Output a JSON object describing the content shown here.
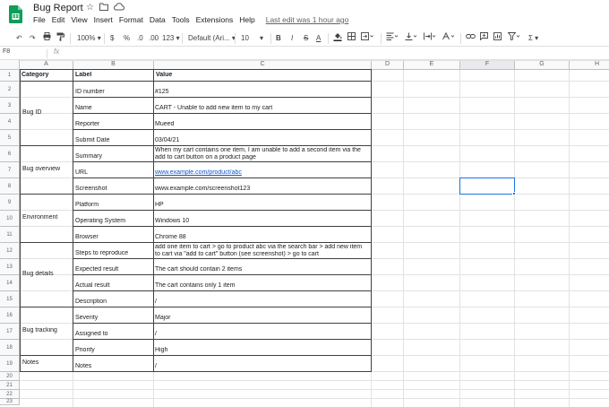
{
  "app": {
    "doc_title": "Bug Report",
    "star_icon": "star-icon",
    "menus": [
      "File",
      "Edit",
      "View",
      "Insert",
      "Format",
      "Data",
      "Tools",
      "Extensions",
      "Help"
    ],
    "last_edit": "Last edit was 1 hour ago"
  },
  "toolbar": {
    "zoom": "100%",
    "currency": "$",
    "percent": "%",
    "dec_decrease": ".0",
    "dec_increase": ".00",
    "more_formats": "123",
    "font": "Default (Ari...",
    "font_size": "10",
    "bold": "B",
    "italic": "I",
    "strike": "S",
    "text_color": "A",
    "functions": "Σ"
  },
  "formula_bar": {
    "name_box": "F8",
    "fx": "fx",
    "content": ""
  },
  "columns": [
    "A",
    "B",
    "C",
    "D",
    "E",
    "F",
    "G",
    "H"
  ],
  "rows": [
    "1",
    "2",
    "3",
    "4",
    "5",
    "6",
    "7",
    "8",
    "9",
    "10",
    "11",
    "12",
    "13",
    "14",
    "15",
    "16",
    "17",
    "18",
    "19",
    "20",
    "21",
    "22",
    "23"
  ],
  "header": {
    "category": "Category",
    "label": "Label",
    "value": "Value"
  },
  "categories": [
    "Bug ID",
    "Bug overview",
    "Environment",
    "Bug details",
    "Bug tracking",
    "Notes"
  ],
  "entries": [
    {
      "label": "ID number",
      "value": "#125"
    },
    {
      "label": "Name",
      "value": "CART - Unable to add new item to my cart"
    },
    {
      "label": "Reporter",
      "value": "Mueed"
    },
    {
      "label": "Submit Date",
      "value": "03/04/21"
    },
    {
      "label": "Summary",
      "value": "When my cart contains one item, I am unable to add a second item via the",
      "value2": "add to cart button on a product page"
    },
    {
      "label": "URL",
      "value": "www.example.com/product/abc"
    },
    {
      "label": "Screenshot",
      "value": "www.example.com/screenshot123"
    },
    {
      "label": "Platform",
      "value": "HP"
    },
    {
      "label": "Operating System",
      "value": "Windows 10"
    },
    {
      "label": "Browser",
      "value": "Chrome 88"
    },
    {
      "label": "Steps to reproduce",
      "value": "add one item to cart > go to product abc via the search bar > add new item",
      "value2": "to cart via \"add to cart\" button (see screenshot) > go to cart"
    },
    {
      "label": "Expected result",
      "value": "The cart should contain 2 items"
    },
    {
      "label": "Actual result",
      "value": "The cart contains only 1 item"
    },
    {
      "label": "Description",
      "value": "/"
    },
    {
      "label": "Severity",
      "value": "Major"
    },
    {
      "label": "Assigned to",
      "value": "/"
    },
    {
      "label": "Priority",
      "value": "High"
    },
    {
      "label": "Notes",
      "value": "/"
    }
  ]
}
